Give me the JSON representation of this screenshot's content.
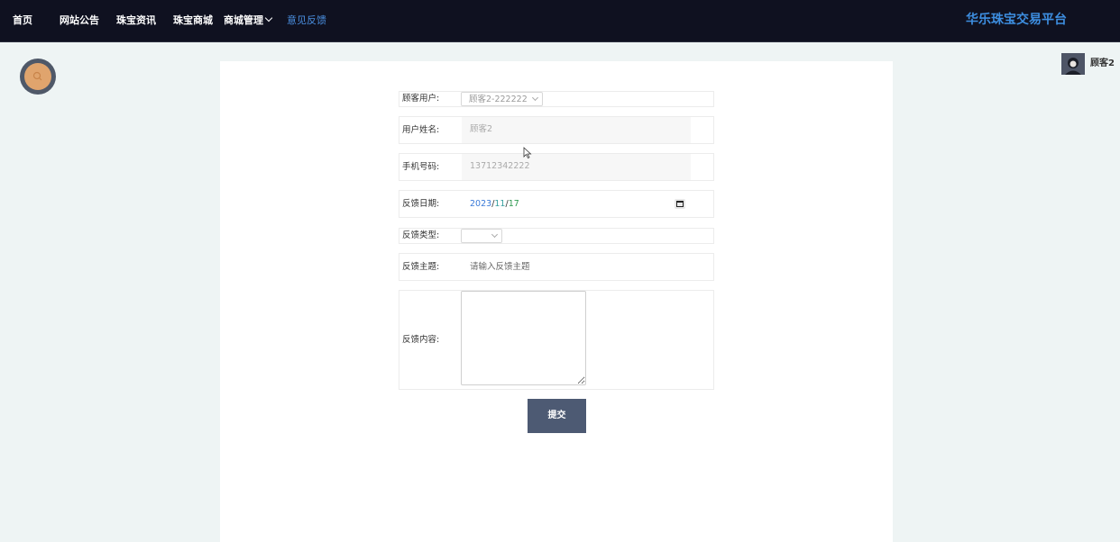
{
  "nav": {
    "items": [
      {
        "label": "首页"
      },
      {
        "label": "网站公告"
      },
      {
        "label": "珠宝资讯"
      },
      {
        "label": "珠宝商城"
      },
      {
        "label": "商城管理"
      },
      {
        "label": "意见反馈"
      }
    ],
    "active_color": "#4a8fe0",
    "brand": "华乐珠宝交易平台"
  },
  "search": {
    "icon": "search-icon",
    "color": "#e0a46d"
  },
  "user": {
    "name": "顾客2"
  },
  "form": {
    "customer_user": {
      "label": "顾客用户:",
      "value": "顾客2-222222"
    },
    "user_name": {
      "label": "用户姓名:",
      "value": "顾客2"
    },
    "phone": {
      "label": "手机号码:",
      "value": "13712342222"
    },
    "feedback_date": {
      "label": "反馈日期:",
      "year": "2023",
      "month": "11",
      "day": "17",
      "sep": "/"
    },
    "feedback_type": {
      "label": "反馈类型:",
      "value": ""
    },
    "feedback_subject": {
      "label": "反馈主题:",
      "placeholder": "请输入反馈主题"
    },
    "feedback_content": {
      "label": "反馈内容:",
      "value": ""
    },
    "submit_label": "提交"
  },
  "colors": {
    "nav_bg": "#0f1120",
    "brand": "#3d8ee0",
    "submit_bg": "#4d5a73"
  }
}
